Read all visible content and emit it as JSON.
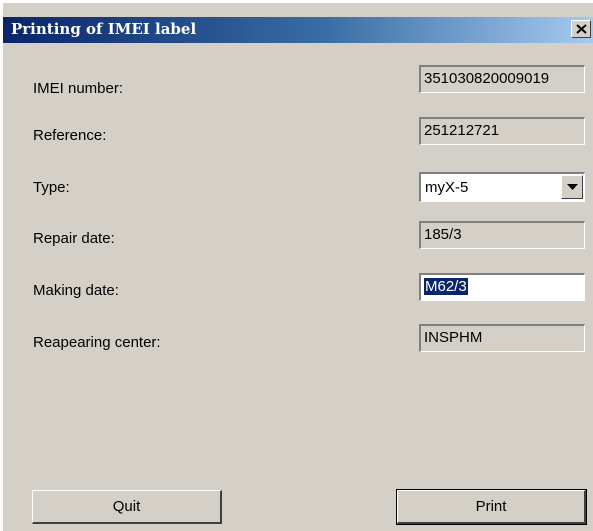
{
  "window": {
    "title": "Printing of IMEI label",
    "close_icon": "close-icon"
  },
  "form": {
    "imei": {
      "label": "IMEI number:",
      "value": "351030820009019"
    },
    "reference": {
      "label": "Reference:",
      "value": "251212721"
    },
    "type": {
      "label": "Type:",
      "value": "myX-5"
    },
    "repair_date": {
      "label": "Repair date:",
      "value": "185/3"
    },
    "making_date": {
      "label": "Making date:",
      "value": "M62/3"
    },
    "center": {
      "label": "Reapearing center:",
      "value": "INSPHM"
    }
  },
  "buttons": {
    "quit": "Quit",
    "print": "Print"
  },
  "colors": {
    "title_start": "#0a246a",
    "title_end": "#a6caf0",
    "face": "#d4d0c8",
    "selection": "#0a246a"
  }
}
